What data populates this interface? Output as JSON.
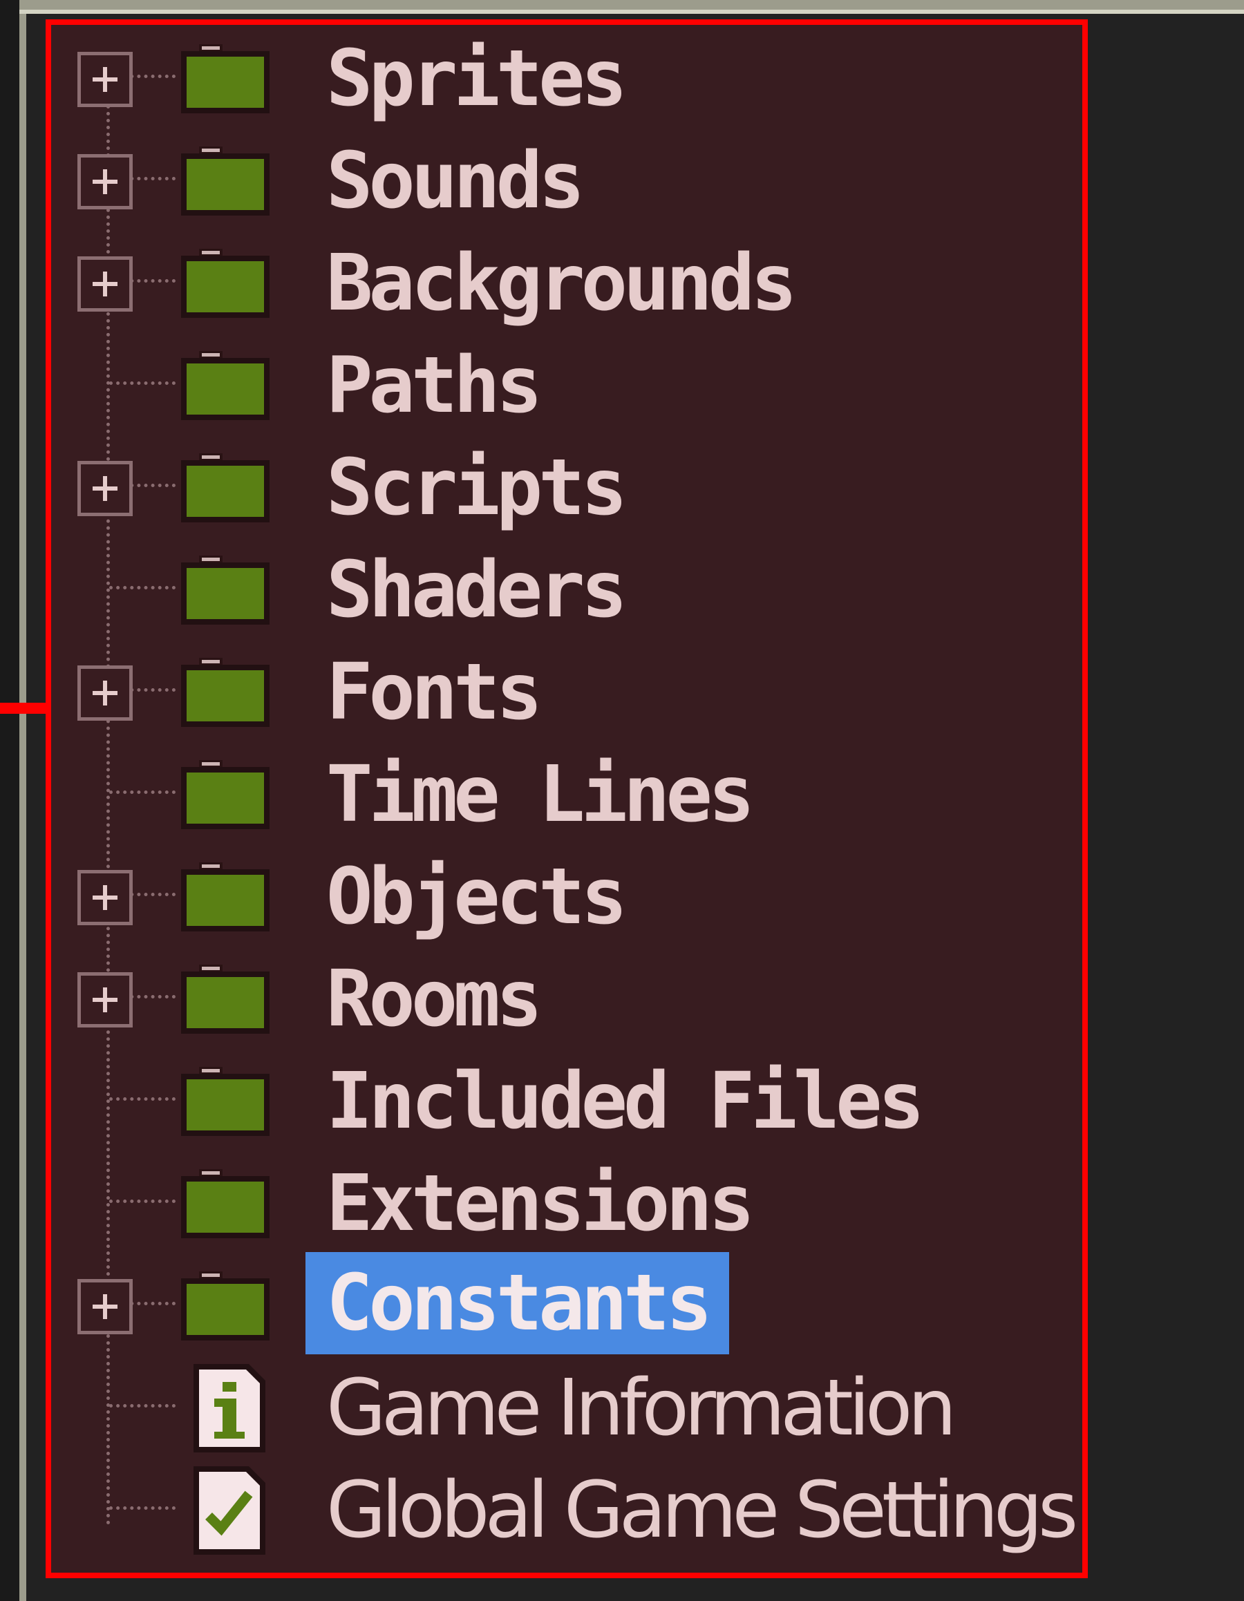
{
  "colors": {
    "panel_bg": "#381c20",
    "highlight_border": "#ff0000",
    "folder": "#5a8014",
    "text": "#e6cccc",
    "selection": "#4a8ae2"
  },
  "tree": {
    "items": [
      {
        "label": "Sprites",
        "icon": "folder-icon",
        "expandable": true
      },
      {
        "label": "Sounds",
        "icon": "folder-icon",
        "expandable": true
      },
      {
        "label": "Backgrounds",
        "icon": "folder-icon",
        "expandable": true
      },
      {
        "label": "Paths",
        "icon": "folder-icon",
        "expandable": false
      },
      {
        "label": "Scripts",
        "icon": "folder-icon",
        "expandable": true
      },
      {
        "label": "Shaders",
        "icon": "folder-icon",
        "expandable": false
      },
      {
        "label": "Fonts",
        "icon": "folder-icon",
        "expandable": true
      },
      {
        "label": "Time Lines",
        "icon": "folder-icon",
        "expandable": false
      },
      {
        "label": "Objects",
        "icon": "folder-icon",
        "expandable": true
      },
      {
        "label": "Rooms",
        "icon": "folder-icon",
        "expandable": true
      },
      {
        "label": "Included Files",
        "icon": "folder-icon",
        "expandable": false
      },
      {
        "label": "Extensions",
        "icon": "folder-icon",
        "expandable": false
      },
      {
        "label": "Constants",
        "icon": "folder-icon",
        "expandable": true,
        "selected": true
      },
      {
        "label": "Game Information",
        "icon": "info-document-icon",
        "expandable": false
      },
      {
        "label": "Global Game Settings",
        "icon": "settings-checkmark-icon",
        "expandable": false
      }
    ]
  }
}
